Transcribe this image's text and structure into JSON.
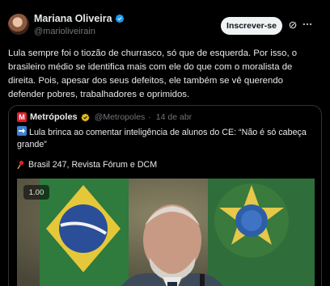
{
  "author": {
    "display_name": "Mariana Oliveira",
    "handle": "@marioliveirain"
  },
  "actions": {
    "subscribe_label": "Inscrever-se"
  },
  "tweet": {
    "text": "Lula sempre foi o tiozão de churrasco, só que de esquerda. Por isso, o brasileiro médio se identifica mais com ele do que com o moralista de direita. Pois, apesar dos seus defeitos, ele também se vê querendo defender pobres, trabalhadores e oprimidos."
  },
  "quote": {
    "name": "Metrópoles",
    "handle": "@Metropoles",
    "separator": "·",
    "date": "14 de abr",
    "headline": "Lula brinca ao comentar inteligência de alunos do CE: “Não é só cabeça grande”",
    "sources": "Brasil 247, Revista Fórum e DCM",
    "media": {
      "speed_label": "1.00"
    }
  },
  "colors": {
    "background": "#000000",
    "text": "#e7e9ea",
    "muted": "#71767b",
    "verified": "#1d9bf0",
    "quote_border": "#2f3336",
    "brand_red": "#e0202a"
  },
  "icons": [
    "verified-badge-icon",
    "grok-icon",
    "more-icon",
    "metropoles-logo",
    "arrow-right-icon",
    "pin-icon"
  ]
}
